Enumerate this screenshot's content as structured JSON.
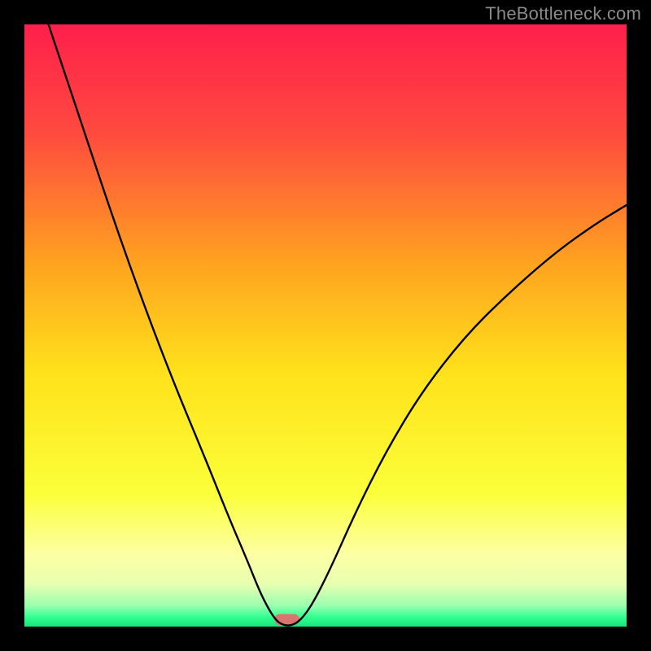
{
  "watermark": "TheBottleneck.com",
  "chart_data": {
    "type": "line",
    "title": "",
    "xlabel": "",
    "ylabel": "",
    "xlim": [
      0,
      100
    ],
    "ylim": [
      0,
      100
    ],
    "gradient_stops": [
      {
        "offset": 0.0,
        "color": "#ff1f4b"
      },
      {
        "offset": 0.18,
        "color": "#ff4a3f"
      },
      {
        "offset": 0.4,
        "color": "#ffa41f"
      },
      {
        "offset": 0.58,
        "color": "#ffe21b"
      },
      {
        "offset": 0.78,
        "color": "#fbff3a"
      },
      {
        "offset": 0.88,
        "color": "#fdffa4"
      },
      {
        "offset": 0.93,
        "color": "#e7ffb0"
      },
      {
        "offset": 0.965,
        "color": "#9bffb0"
      },
      {
        "offset": 0.985,
        "color": "#2fff8f"
      },
      {
        "offset": 1.0,
        "color": "#18e47a"
      }
    ],
    "series": [
      {
        "name": "curve",
        "stroke": "#000000",
        "points": [
          {
            "x": 4.0,
            "y": 100.0
          },
          {
            "x": 6.0,
            "y": 94.0
          },
          {
            "x": 10.0,
            "y": 82.0
          },
          {
            "x": 15.0,
            "y": 67.0
          },
          {
            "x": 20.0,
            "y": 53.0
          },
          {
            "x": 25.0,
            "y": 40.0
          },
          {
            "x": 30.0,
            "y": 28.0
          },
          {
            "x": 34.0,
            "y": 18.0
          },
          {
            "x": 37.0,
            "y": 11.0
          },
          {
            "x": 39.0,
            "y": 6.0
          },
          {
            "x": 40.5,
            "y": 3.0
          },
          {
            "x": 41.8,
            "y": 1.0
          },
          {
            "x": 43.0,
            "y": 0.2
          },
          {
            "x": 44.5,
            "y": 0.2
          },
          {
            "x": 46.0,
            "y": 1.2
          },
          {
            "x": 48.0,
            "y": 4.0
          },
          {
            "x": 51.0,
            "y": 10.0
          },
          {
            "x": 55.0,
            "y": 19.0
          },
          {
            "x": 60.0,
            "y": 29.0
          },
          {
            "x": 66.0,
            "y": 39.0
          },
          {
            "x": 73.0,
            "y": 48.0
          },
          {
            "x": 80.0,
            "y": 55.0
          },
          {
            "x": 88.0,
            "y": 62.0
          },
          {
            "x": 95.0,
            "y": 67.0
          },
          {
            "x": 100.0,
            "y": 70.0
          }
        ]
      }
    ],
    "marker": {
      "x": 43.6,
      "y": 0.0,
      "width": 4.2,
      "height": 1.8,
      "color": "#d9756f"
    }
  }
}
